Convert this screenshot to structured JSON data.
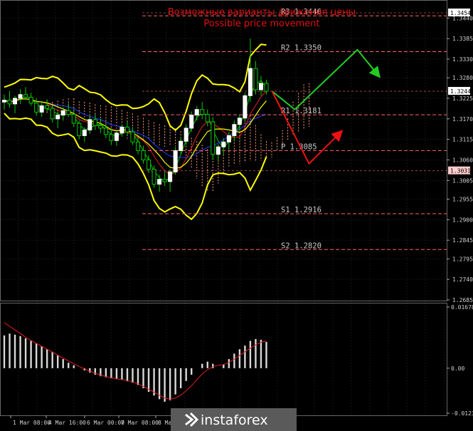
{
  "chart_data": {
    "type": "line",
    "title": "Возможные варианты движения цены",
    "subtitle": "Possible price movement",
    "price_axis": {
      "ylim": [
        1.2685,
        1.3454
      ],
      "ticks": [
        "1.3440",
        "1.3385",
        "1.3330",
        "1.3280",
        "1.3225",
        "1.3170",
        "1.3115",
        "1.3060",
        "1.3005",
        "1.2955",
        "1.2900",
        "1.2845",
        "1.2795",
        "1.2740",
        "1.2685"
      ],
      "tick_values": [
        1.344,
        1.3385,
        1.333,
        1.328,
        1.3225,
        1.317,
        1.3115,
        1.306,
        1.3005,
        1.2955,
        1.29,
        1.2845,
        1.2795,
        1.274,
        1.2685
      ],
      "highlight_boxes": [
        {
          "label": "1.3454",
          "value": 1.3454,
          "color": "#ffffff"
        },
        {
          "label": "1.3244",
          "value": 1.3244,
          "color": "#ffffff"
        },
        {
          "label": "1.3031",
          "value": 1.3031,
          "color": "#ffcccc"
        }
      ]
    },
    "levels": [
      {
        "name": "R3",
        "label": "R3 1.3446",
        "value": 1.3446
      },
      {
        "name": "R2",
        "label": "R2 1.3350",
        "value": 1.335
      },
      {
        "name": "R1",
        "label": "R1 1.3181",
        "value": 1.3181
      },
      {
        "name": "P",
        "label": "P 1.3085",
        "value": 1.3085
      },
      {
        "name": "S1",
        "label": "S1 1.2916",
        "value": 1.2916
      },
      {
        "name": "S2",
        "label": "S2 1.2820",
        "value": 1.282
      }
    ],
    "x_ticks": [
      "1 Mar 08:00",
      "4 Mar 16:00",
      "6 Mar 00:00",
      "7 Mar 08:00",
      "8 Mar"
    ],
    "candles": [
      [
        1.3215,
        1.3235,
        1.3195,
        1.322
      ],
      [
        1.322,
        1.3245,
        1.32,
        1.321
      ],
      [
        1.321,
        1.3232,
        1.3185,
        1.3225
      ],
      [
        1.3225,
        1.325,
        1.321,
        1.3235
      ],
      [
        1.3235,
        1.3255,
        1.322,
        1.3228
      ],
      [
        1.3228,
        1.324,
        1.3205,
        1.3212
      ],
      [
        1.3212,
        1.3225,
        1.3178,
        1.3188
      ],
      [
        1.3188,
        1.3215,
        1.3175,
        1.3205
      ],
      [
        1.3205,
        1.3222,
        1.319,
        1.3198
      ],
      [
        1.3198,
        1.3205,
        1.316,
        1.317
      ],
      [
        1.317,
        1.319,
        1.3145,
        1.318
      ],
      [
        1.318,
        1.32,
        1.3165,
        1.3192
      ],
      [
        1.3192,
        1.3212,
        1.3175,
        1.3182
      ],
      [
        1.3182,
        1.3195,
        1.3148,
        1.3158
      ],
      [
        1.3158,
        1.3165,
        1.3115,
        1.3125
      ],
      [
        1.3125,
        1.3148,
        1.3108,
        1.314
      ],
      [
        1.314,
        1.3178,
        1.313,
        1.3168
      ],
      [
        1.3168,
        1.3182,
        1.314,
        1.3152
      ],
      [
        1.3152,
        1.317,
        1.3132,
        1.3145
      ],
      [
        1.3145,
        1.3158,
        1.3118,
        1.3128
      ],
      [
        1.3128,
        1.3145,
        1.31,
        1.3112
      ],
      [
        1.3112,
        1.3138,
        1.3098,
        1.3132
      ],
      [
        1.3132,
        1.3155,
        1.3122,
        1.3148
      ],
      [
        1.3148,
        1.3162,
        1.3125,
        1.3135
      ],
      [
        1.3135,
        1.3148,
        1.31,
        1.3108
      ],
      [
        1.3108,
        1.3122,
        1.3075,
        1.3085
      ],
      [
        1.3085,
        1.3098,
        1.305,
        1.306
      ],
      [
        1.306,
        1.3072,
        1.3025,
        1.3035
      ],
      [
        1.3035,
        1.3045,
        1.2985,
        1.2995
      ],
      [
        1.2995,
        1.302,
        1.2975,
        1.3008
      ],
      [
        1.3008,
        1.303,
        1.299,
        1.3002
      ],
      [
        1.3002,
        1.3035,
        1.2975,
        1.3028
      ],
      [
        1.3028,
        1.3095,
        1.302,
        1.3085
      ],
      [
        1.3085,
        1.312,
        1.3075,
        1.311
      ],
      [
        1.311,
        1.3155,
        1.31,
        1.3145
      ],
      [
        1.3145,
        1.319,
        1.3135,
        1.318
      ],
      [
        1.318,
        1.3205,
        1.3165,
        1.3195
      ],
      [
        1.3195,
        1.3215,
        1.317,
        1.3182
      ],
      [
        1.3182,
        1.3195,
        1.315,
        1.3162
      ],
      [
        1.3162,
        1.3175,
        1.306,
        1.3075
      ],
      [
        1.3075,
        1.3102,
        1.3055,
        1.3095
      ],
      [
        1.3095,
        1.3118,
        1.3075,
        1.3108
      ],
      [
        1.3108,
        1.3135,
        1.309,
        1.3125
      ],
      [
        1.3125,
        1.3165,
        1.311,
        1.3155
      ],
      [
        1.3155,
        1.3182,
        1.3138,
        1.3172
      ],
      [
        1.3172,
        1.324,
        1.3162,
        1.3232
      ],
      [
        1.3232,
        1.3385,
        1.3215,
        1.3305
      ],
      [
        1.3305,
        1.3325,
        1.3235,
        1.3248
      ],
      [
        1.3248,
        1.3285,
        1.3232,
        1.3265
      ],
      [
        1.3265,
        1.3275,
        1.3235,
        1.3244
      ]
    ],
    "scenario_up": [
      [
        1.3244,
        1.3244
      ],
      [
        1.3195,
        1.3195
      ],
      [
        1.3355,
        1.3355
      ],
      [
        1.3285,
        1.3285
      ]
    ],
    "scenario_down": [
      [
        1.3244,
        1.3244
      ],
      [
        1.305,
        1.305
      ],
      [
        1.3135,
        1.3135
      ]
    ],
    "macd": {
      "ylim": [
        -0.01235,
        0.01678
      ],
      "ticks": [
        "0.01678",
        "0.00",
        "-0.01235"
      ],
      "tick_values": [
        0.01678,
        0,
        -0.01235
      ],
      "histogram": [
        0.009,
        0.0095,
        0.0092,
        0.0088,
        0.0082,
        0.0075,
        0.0068,
        0.006,
        0.0052,
        0.0045,
        0.0035,
        0.0025,
        0.0015,
        0.0008,
        0.0,
        -0.0006,
        -0.0012,
        -0.0018,
        -0.0022,
        -0.0025,
        -0.0028,
        -0.003,
        -0.0032,
        -0.0036,
        -0.004,
        -0.0046,
        -0.0055,
        -0.0065,
        -0.0075,
        -0.0085,
        -0.0092,
        -0.0088,
        -0.0072,
        -0.0055,
        -0.0035,
        -0.0018,
        0.0,
        0.0012,
        0.0018,
        0.0012,
        0.0,
        0.001,
        0.0025,
        0.004,
        0.0052,
        0.0062,
        0.0075,
        0.008,
        0.0078,
        0.0072
      ],
      "signal": [
        0.0125,
        0.0115,
        0.0105,
        0.0095,
        0.0085,
        0.0076,
        0.0068,
        0.006,
        0.0052,
        0.0044,
        0.0036,
        0.0028,
        0.002,
        0.0012,
        0.0005,
        -0.0002,
        -0.0008,
        -0.0014,
        -0.0019,
        -0.0023,
        -0.0026,
        -0.0029,
        -0.0031,
        -0.0034,
        -0.0038,
        -0.0043,
        -0.005,
        -0.0058,
        -0.0066,
        -0.0074,
        -0.0082,
        -0.0085,
        -0.0082,
        -0.0074,
        -0.0062,
        -0.0048,
        -0.0032,
        -0.0016,
        -0.0004,
        0.0004,
        0.0008,
        0.001,
        0.0016,
        0.0025,
        0.0035,
        0.0045,
        0.0055,
        0.0064,
        0.0071,
        0.0075
      ]
    },
    "colors": {
      "background": "#000000",
      "grid": "#1f2a1f",
      "candle_up": "#ffffff",
      "candle_down": "#00cc00",
      "candle_wick": "#00cc00",
      "bands": "#ffff00",
      "ma_blue": "#2040ff",
      "ma_red": "#e02020",
      "ichimoku_lines": "#00c000",
      "cloud": "#ff9a7a",
      "level_line": "#ff6666",
      "scenario_up": "#22cc22",
      "scenario_down": "#ee1111",
      "macd_hist": "#d8d8d8",
      "macd_signal": "#e02020",
      "title": "#e01010"
    }
  },
  "logo": {
    "text": "instaforex",
    "icon": "instaforex-logo-icon"
  }
}
